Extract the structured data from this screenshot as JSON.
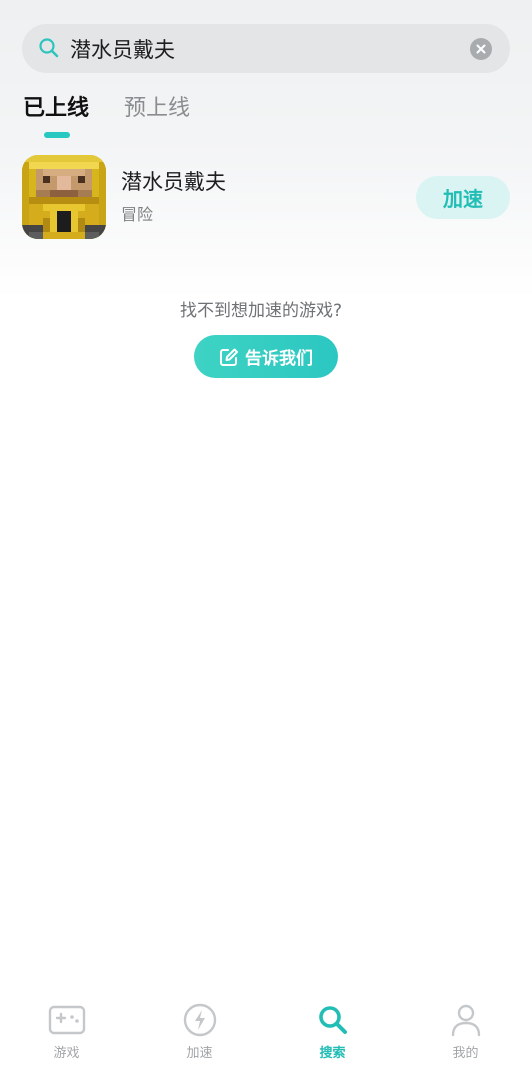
{
  "search": {
    "value": "潜水员戴夫",
    "placeholder": ""
  },
  "tabs": [
    {
      "label": "已上线",
      "active": true
    },
    {
      "label": "预上线",
      "active": false
    }
  ],
  "games": [
    {
      "title": "潜水员戴夫",
      "genre": "冒险",
      "action_label": "加速",
      "icon": "pixel-diver-helmet-icon"
    }
  ],
  "not_found": {
    "text": "找不到想加速的游戏?",
    "button_label": "告诉我们"
  },
  "bottom_nav": [
    {
      "label": "游戏",
      "icon": "gamepad-icon",
      "active": false
    },
    {
      "label": "加速",
      "icon": "lightning-icon",
      "active": false
    },
    {
      "label": "搜索",
      "icon": "search-icon",
      "active": true
    },
    {
      "label": "我的",
      "icon": "user-icon",
      "active": false
    }
  ],
  "colors": {
    "accent": "#27c8c0",
    "accent_light": "#d9f4f2",
    "inactive": "#a2a5a8"
  }
}
